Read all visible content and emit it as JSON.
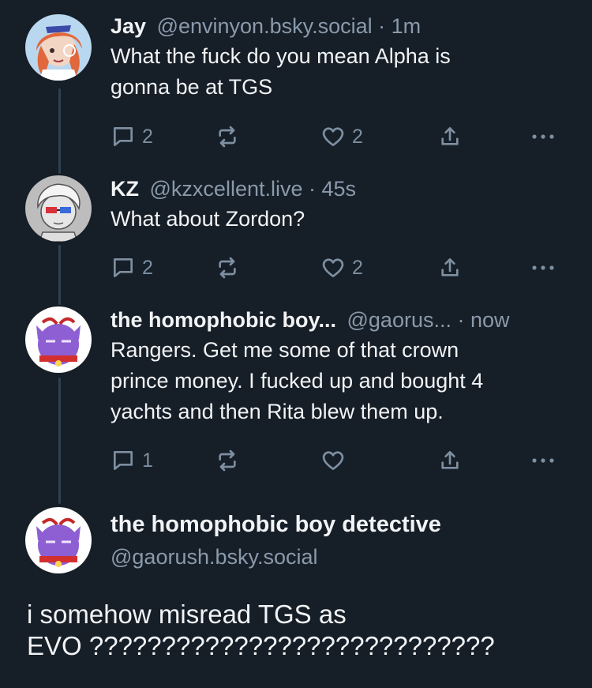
{
  "posts": [
    {
      "name": "Jay",
      "handle": "@envinyon.bsky.social",
      "time": "1m",
      "lines": [
        "What the fuck do you mean Alpha is",
        "gonna be at TGS"
      ],
      "reply_count": "2",
      "like_count": "2"
    },
    {
      "name": "KZ",
      "handle": "@kzxcellent.live",
      "time": "45s",
      "lines": [
        "What about Zordon?"
      ],
      "reply_count": "2",
      "like_count": "2"
    },
    {
      "name": "the homophobic boy...",
      "handle": "@gaorus...",
      "time": "now",
      "lines": [
        "Rangers. Get me some of that crown",
        "prince money. I fucked up and bought 4",
        "yachts and then Rita blew them up."
      ],
      "reply_count": "1",
      "like_count": ""
    }
  ],
  "focused_post": {
    "name": "the homophobic boy detective",
    "handle": "@gaorush.bsky.social",
    "lines": [
      "i somehow misread TGS as",
      "EVO ????????????????????????????"
    ]
  },
  "meta_separator": " · ",
  "icons": [
    "reply-icon",
    "repost-icon",
    "like-icon",
    "share-icon",
    "more-icon"
  ],
  "colors": {
    "background": "#161e27",
    "text": "#f1f3f5",
    "muted": "#8a9aab",
    "thread_line": "#2e4052",
    "icon": "#7d8fa1"
  }
}
